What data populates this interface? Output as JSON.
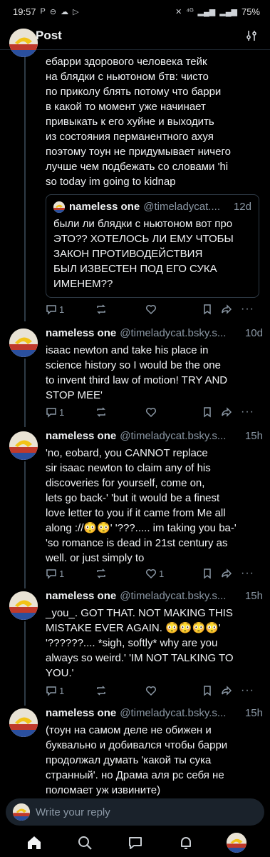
{
  "status": {
    "time": "19:57",
    "battery": "75%",
    "left_icons": [
      "p-app-icon",
      "minus-circle-icon",
      "cloud-icon",
      "play-store-icon"
    ],
    "right_icons": [
      "mute-icon",
      "4g-icon",
      "signal-icon",
      "signal-icon-2"
    ]
  },
  "header": {
    "title": "Post"
  },
  "posts": [
    {
      "id": "root",
      "name": "",
      "handle": "",
      "time": "",
      "text": "ебарри здорового человека тейк\nна блядки с ньютоном бтв: чисто\nпо приколу блять потому что барри\nв какой то момент уже начинает\nпривыкать к его хуйне и выходить\nиз состояния перманентного ахуя\nпоэтому тоун не придумывает ничего\nлучше чем подбежать со словами 'hi\nso today im going to kidnap",
      "quote": {
        "name": "nameless one",
        "handle": "@timeladycat....",
        "time": "12d",
        "text": "были ли блядки с ньютоном вот про\nЭТО?? ХОТЕЛОСЬ ЛИ ЕМУ ЧТОБЫ\nЗАКОН ПРОТИВОДЕЙСТВИЯ\nБЫЛ ИЗВЕСТЕН ПОД ЕГО СУКА\nИМЕНЕМ??"
      },
      "reply_count": "1",
      "like_count": ""
    },
    {
      "id": "p2",
      "name": "nameless one",
      "handle": "@timeladycat.bsky.s...",
      "time": "10d",
      "text": "isaac newton and take his place in\nscience history so I would be the one\nto invent third law of motion! TRY AND\nSTOP MEE'",
      "reply_count": "1",
      "like_count": ""
    },
    {
      "id": "p3",
      "name": "nameless one",
      "handle": "@timeladycat.bsky.s...",
      "time": "15h",
      "text": "'no, eobard, you CANNOT replace\nsir isaac newton to claim any of his\ndiscoveries for yourself, come on,\nlets go back-' 'but it would be a finest\nlove letter to you if it came from Me all\nalong ://😳😳' '???..... im taking you ba-'\n'so romance is dead in 21st century as\nwell. or just simply to",
      "reply_count": "1",
      "like_count": "1"
    },
    {
      "id": "p4",
      "name": "nameless one",
      "handle": "@timeladycat.bsky.s...",
      "time": "15h",
      "text": "_you_. GOT THAT. NOT MAKING THIS\nMISTAKE EVER AGAIN. 😳😳😳😳'\n'??????.... *sigh, softly* why are you\nalways so weird.' 'IM NOT TALKING TO\nYOU.'",
      "reply_count": "1",
      "like_count": ""
    },
    {
      "id": "p5",
      "name": "nameless one",
      "handle": "@timeladycat.bsky.s...",
      "time": "15h",
      "text": "(тоун на самом деле не обижен и\nбуквально и добивался чтобы барри\nпродолжал думать 'какой ты сука\nстранный'. но Драма аля рс себя не\nполомает уж извините)",
      "reply_count": "",
      "like_count": ""
    }
  ],
  "reply_bar": {
    "placeholder": "Write your reply"
  },
  "nav": [
    "home-icon",
    "search-icon",
    "chat-icon",
    "notifications-icon",
    "profile-avatar"
  ]
}
